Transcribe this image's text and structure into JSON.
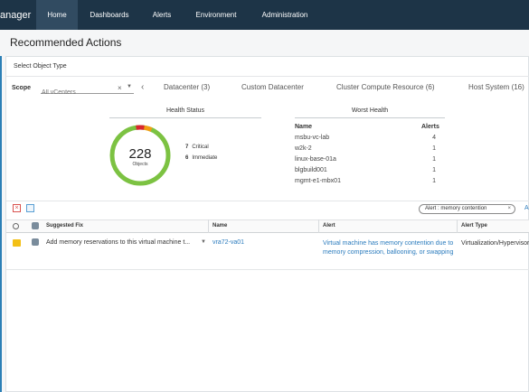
{
  "app": {
    "title": "anager"
  },
  "nav": {
    "items": [
      {
        "label": "Home",
        "active": true
      },
      {
        "label": "Dashboards"
      },
      {
        "label": "Alerts"
      },
      {
        "label": "Environment"
      },
      {
        "label": "Administration"
      }
    ]
  },
  "page": {
    "title": "Recommended Actions"
  },
  "object_type": {
    "label": "Select Object Type"
  },
  "scope": {
    "label": "Scope",
    "placeholder": "All vCenters"
  },
  "tabs": [
    {
      "label": "Datacenter (3)"
    },
    {
      "label": "Custom Datacenter"
    },
    {
      "label": "Cluster Compute Resource (6)"
    },
    {
      "label": "Host System (16)"
    }
  ],
  "health_status": {
    "title": "Health Status",
    "total": "228",
    "total_label": "Objects",
    "critical_count": "7",
    "critical_label": "Critical",
    "immediate_count": "6",
    "immediate_label": "Immediate",
    "colors": {
      "healthy": "#7cc242",
      "critical": "#d9272e",
      "immediate": "#f39c12"
    }
  },
  "worst_health": {
    "title": "Worst Health",
    "col_name": "Name",
    "col_alerts": "Alerts",
    "rows": [
      {
        "name": "msbu-vc-lab",
        "alerts": "4"
      },
      {
        "name": "w2k-2",
        "alerts": "1"
      },
      {
        "name": "linux-base-01a",
        "alerts": "1"
      },
      {
        "name": "blgbuild001",
        "alerts": "1"
      },
      {
        "name": "mgmt-e1-mbx01",
        "alerts": "1"
      }
    ]
  },
  "filter": {
    "chip": "Alert : memory contention",
    "extra": "A"
  },
  "grid": {
    "headers": {
      "fix": "Suggested Fix",
      "name": "Name",
      "alert": "Alert",
      "type": "Alert Type"
    },
    "rows": [
      {
        "fix": "Add memory reservations to this virtual machine t...",
        "name": "vra72-va01",
        "alert": "Virtual machine has memory contention due to memory compression, ballooning, or swapping",
        "type": "Virtualization/Hypervisor Alerts"
      }
    ]
  }
}
